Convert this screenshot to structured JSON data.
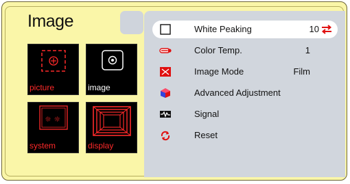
{
  "title": "Image",
  "thumbnails": [
    {
      "label": "picture",
      "icon": "picture-icon",
      "selected": false
    },
    {
      "label": "image",
      "icon": "image-icon",
      "selected": true
    },
    {
      "label": "system",
      "icon": "system-icon",
      "selected": false
    },
    {
      "label": "display",
      "icon": "display-icon",
      "selected": false
    }
  ],
  "menu": [
    {
      "label": "White Peaking",
      "value": "10",
      "icon": "white-peaking-icon",
      "highlighted": true
    },
    {
      "label": "Color Temp.",
      "value": "1",
      "icon": "color-temp-icon"
    },
    {
      "label": "Image Mode",
      "value": "Film",
      "icon": "image-mode-icon"
    },
    {
      "label": "Advanced Adjustment",
      "value": "",
      "icon": "advanced-adjustment-icon"
    },
    {
      "label": "Signal",
      "value": "",
      "icon": "signal-icon"
    },
    {
      "label": "Reset",
      "value": "",
      "icon": "reset-icon"
    }
  ],
  "colors": {
    "background": "#faf6a8",
    "panel": "#d1d6dd",
    "accent_red": "#ff2a2a",
    "highlight": "#ffffff"
  }
}
